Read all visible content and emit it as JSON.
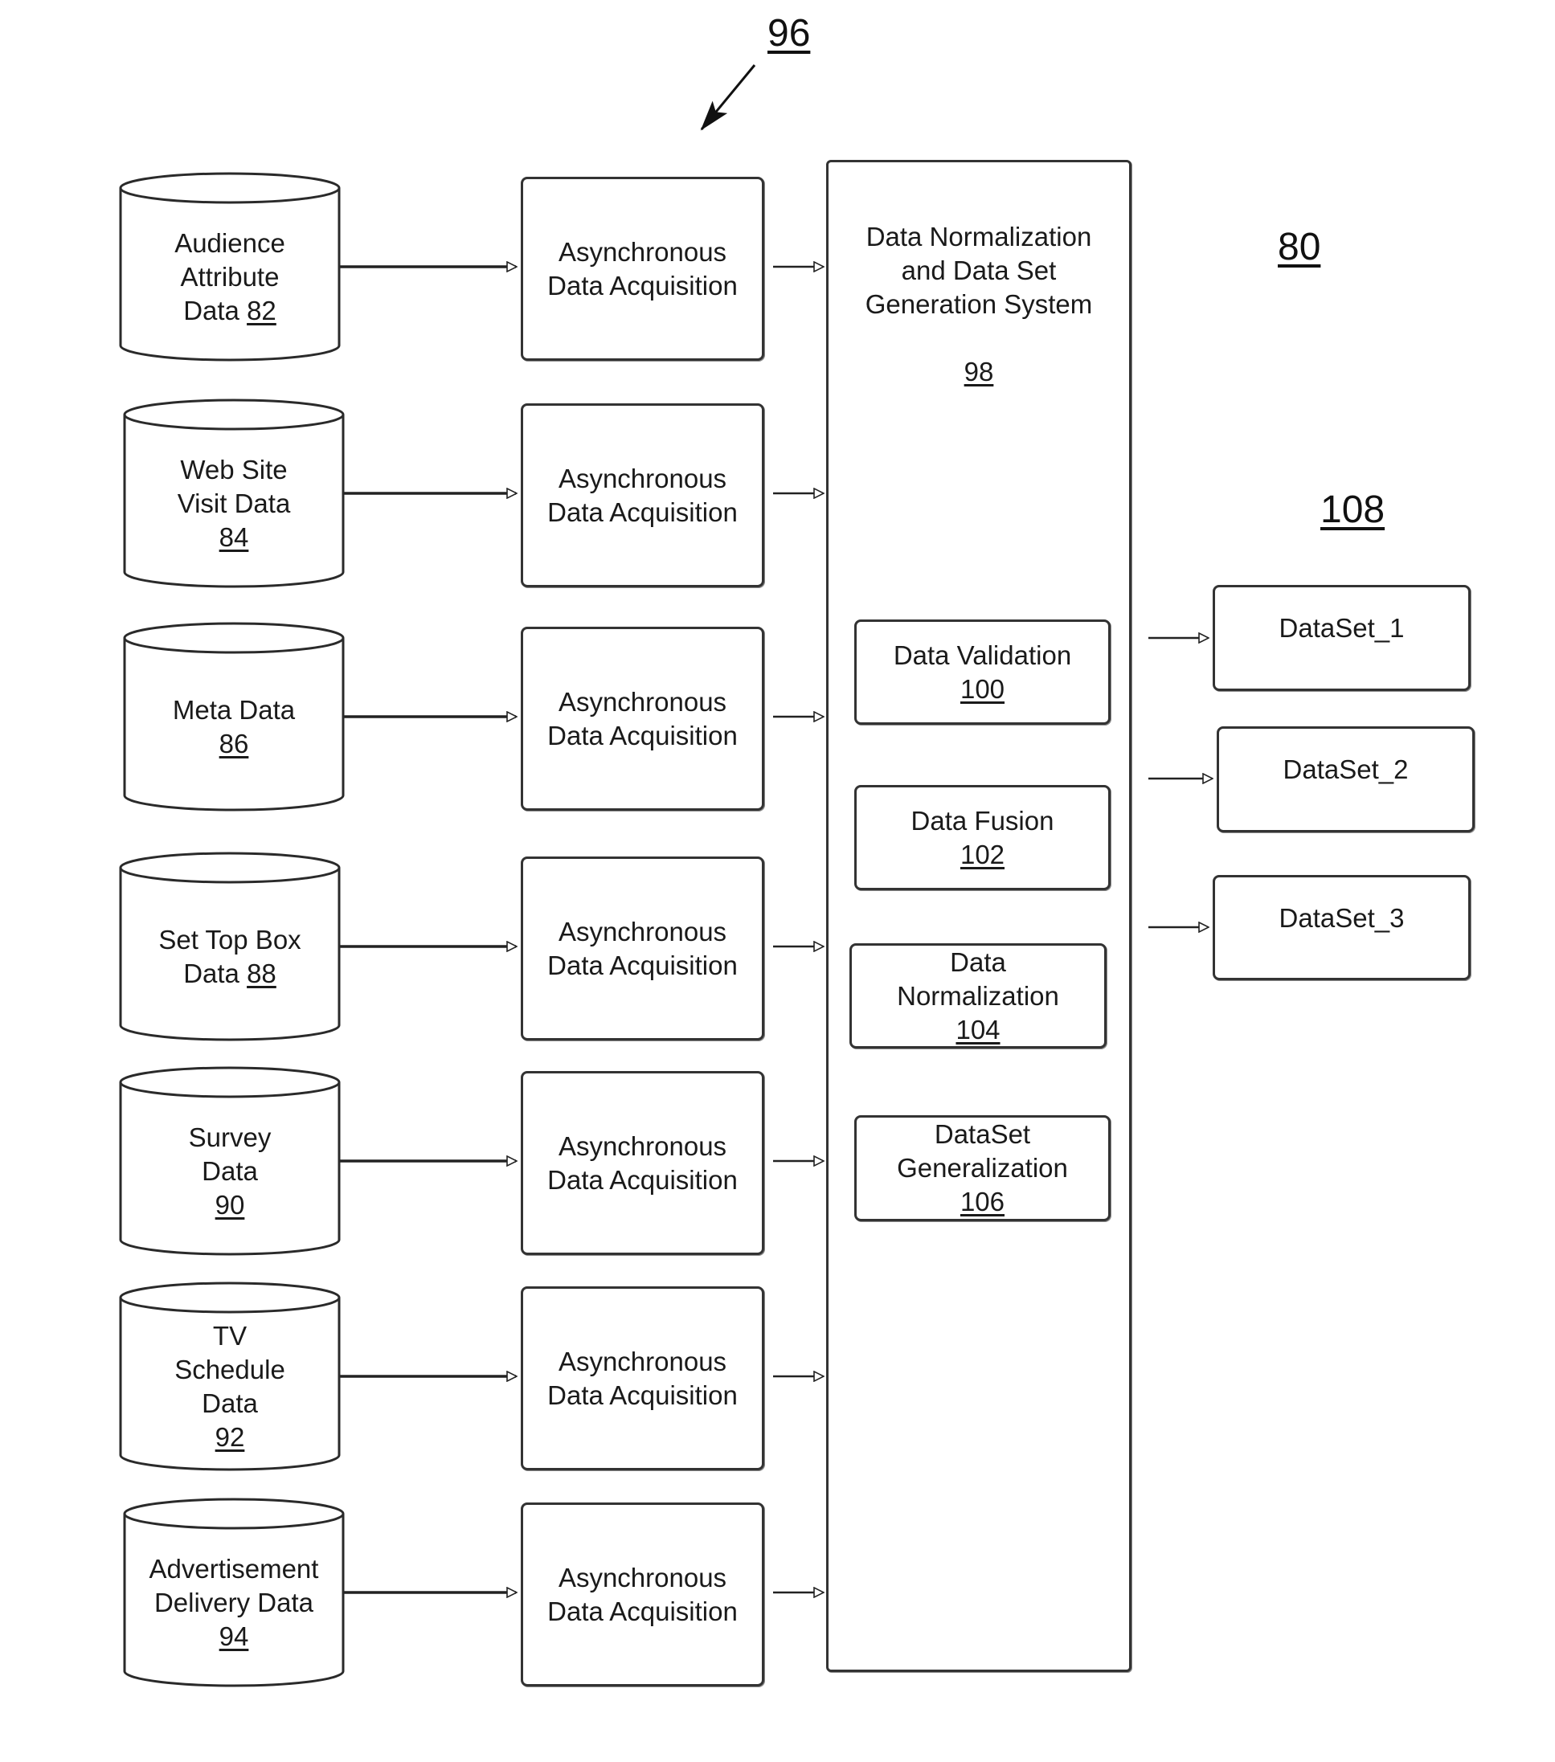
{
  "figure": {
    "ref_system": "80",
    "ref_acquisition": "96",
    "ref_datasets": "108"
  },
  "sources": [
    {
      "lines": [
        "Audience",
        "Attribute"
      ],
      "tail": "Data ",
      "ref": "82"
    },
    {
      "lines": [
        "Web Site",
        "Visit Data"
      ],
      "tail": "",
      "ref": "84"
    },
    {
      "lines": [
        "Meta Data"
      ],
      "tail": "",
      "ref": "86"
    },
    {
      "lines": [
        "Set Top Box"
      ],
      "tail": "Data ",
      "ref": "88"
    },
    {
      "lines": [
        "Survey",
        "Data"
      ],
      "tail": "",
      "ref": "90"
    },
    {
      "lines": [
        "TV",
        "Schedule",
        "Data"
      ],
      "tail": "",
      "ref": "92"
    },
    {
      "lines": [
        "Advertisement",
        "Delivery Data"
      ],
      "tail": "",
      "ref": "94"
    }
  ],
  "acquisition": {
    "line1": "Asynchronous",
    "line2": "Data Acquisition"
  },
  "system": {
    "title_lines": [
      "Data Normalization",
      "and Data Set",
      "Generation System"
    ],
    "ref": "98",
    "modules": [
      {
        "lines": [
          "Data Validation"
        ],
        "ref": "100"
      },
      {
        "lines": [
          "Data Fusion"
        ],
        "ref": "102"
      },
      {
        "lines": [
          "Data",
          "Normalization"
        ],
        "ref": "104"
      },
      {
        "lines": [
          "DataSet",
          "Generalization"
        ],
        "ref": "106"
      }
    ]
  },
  "datasets": [
    "DataSet_1",
    "DataSet_2",
    "DataSet_3"
  ]
}
